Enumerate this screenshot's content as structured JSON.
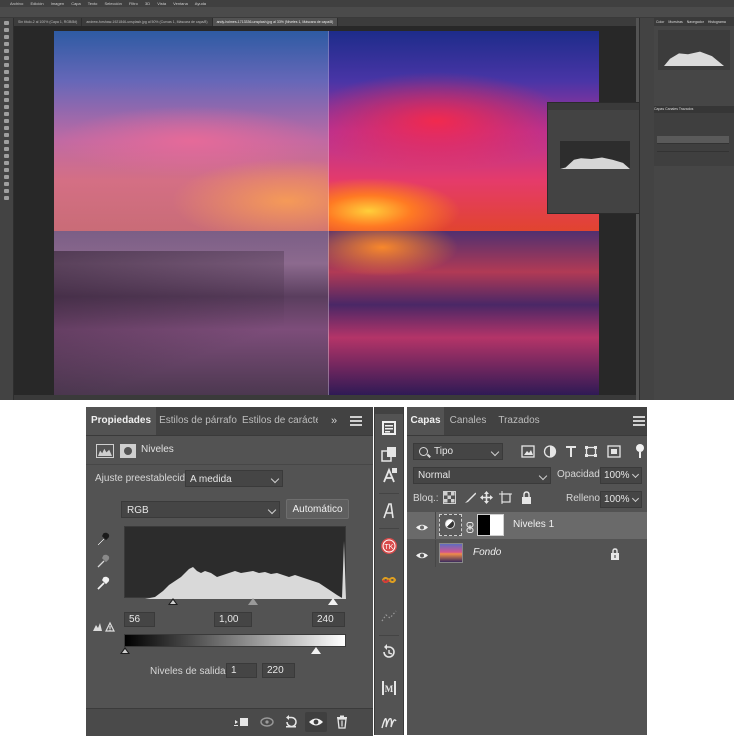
{
  "top_screenshot": {
    "menu_items": [
      "Archivo",
      "Edición",
      "Imagen",
      "Capa",
      "Texto",
      "Selección",
      "Filtro",
      "3D",
      "Vista",
      "Ventana",
      "Ayuda"
    ],
    "doc_tabs": [
      "Sin título-2 al 100% (Capa 1, RGB/8#)",
      "andrew-forshaw-1921846-unsplash.jpg al 50% (Curvas 1, Máscara de capa/8)",
      "andy-holmes-1713336-unsplash.jpg al 33% (Niveles 1, Máscara de capa/8)"
    ],
    "nav_tabs": [
      "Color",
      "Muestras",
      "Navegador",
      "Histograma"
    ],
    "mini_layers_tabs": [
      "Capas",
      "Canales",
      "Trazados"
    ]
  },
  "props": {
    "tabs": [
      "Propiedades",
      "Estilos de párrafo",
      "Estilos de carácter"
    ],
    "collapse": "»",
    "title": "Niveles",
    "preset_label": "Ajuste preestablecido:",
    "preset_value": "A medida",
    "channel": "RGB",
    "auto_button": "Automático",
    "input_black": "56",
    "input_gamma": "1,00",
    "input_white": "240",
    "output_label": "Niveles de salida:",
    "output_black": "1",
    "output_white": "220"
  },
  "histogram": {
    "input_black": 56,
    "input_gamma": 1.0,
    "input_white": 240,
    "output_black": 1,
    "output_white": 220
  },
  "layers": {
    "tabs": [
      "Capas",
      "Canales",
      "Trazados"
    ],
    "filter_value": "Tipo",
    "blend_mode": "Normal",
    "opacity_label": "Opacidad:",
    "opacity_value": "100%",
    "lock_label": "Bloq.:",
    "fill_label": "Relleno:",
    "fill_value": "100%",
    "items": [
      {
        "name": "Niveles 1",
        "selected": true
      },
      {
        "name": "Fondo",
        "selected": false,
        "locked": true
      }
    ]
  },
  "colors": {
    "panel_bg": "#535353",
    "tab_bg": "#424242",
    "selected_row": "#6a6a6a"
  }
}
